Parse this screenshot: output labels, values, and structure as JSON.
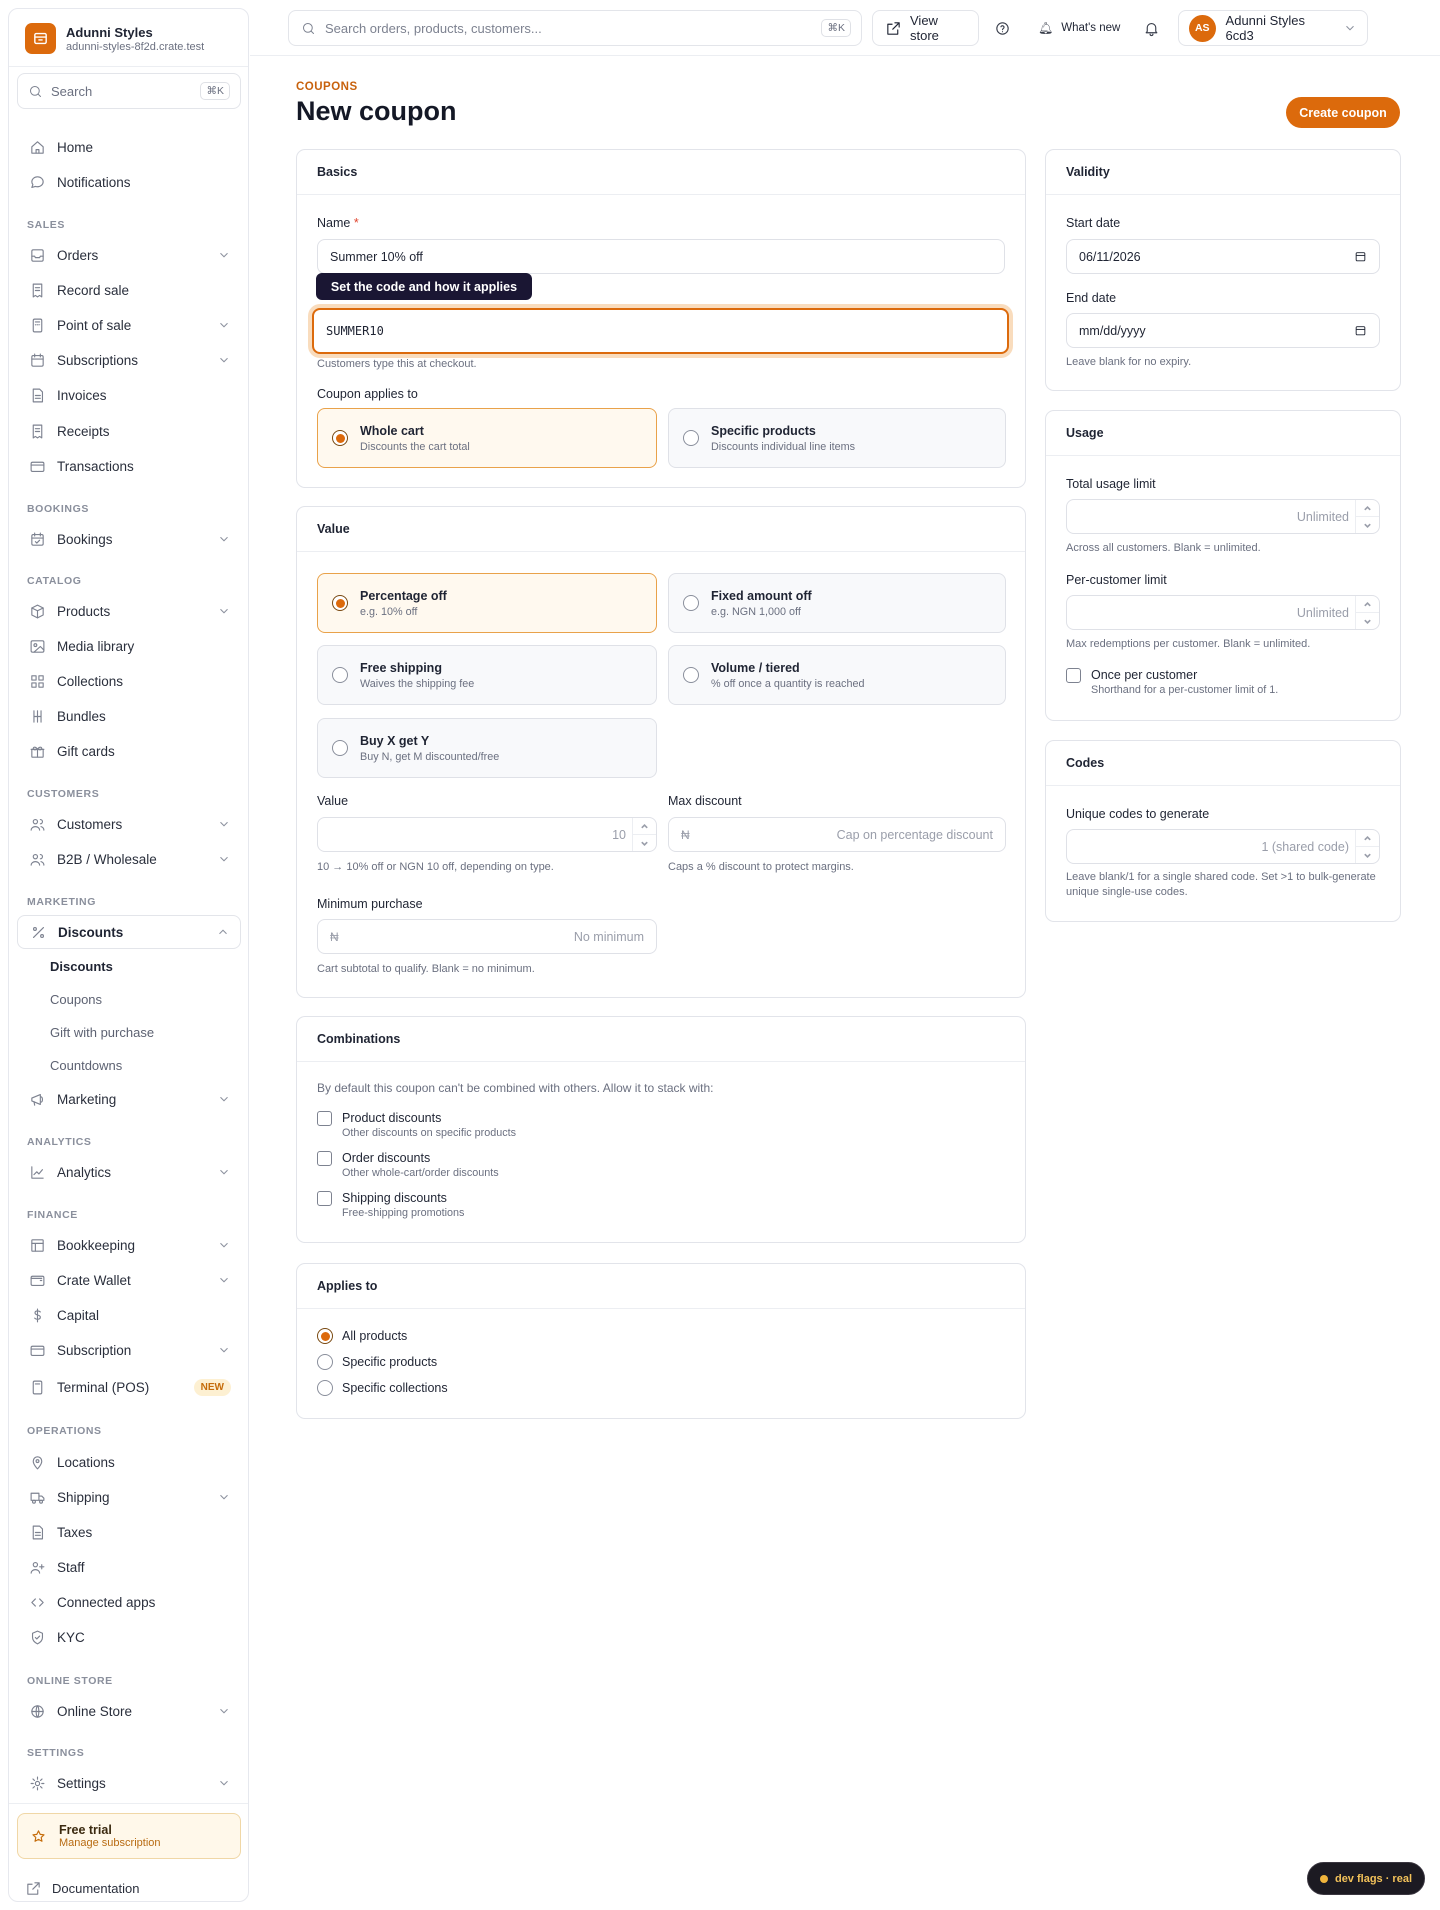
{
  "brand": {
    "name": "Adunni Styles",
    "domain": "adunni-styles-8f2d.crate.test"
  },
  "sidebar_search": {
    "placeholder": "Search",
    "shortcut": "⌘K"
  },
  "nav": {
    "home": "Home",
    "notifications": "Notifications",
    "sales": "SALES",
    "orders": "Orders",
    "record_sale": "Record sale",
    "pos": "Point of sale",
    "subscriptions": "Subscriptions",
    "invoices": "Invoices",
    "receipts": "Receipts",
    "transactions": "Transactions",
    "bookings_section": "BOOKINGS",
    "bookings": "Bookings",
    "catalog": "CATALOG",
    "products": "Products",
    "media": "Media library",
    "collections": "Collections",
    "bundles": "Bundles",
    "gift_cards": "Gift cards",
    "customers_section": "CUSTOMERS",
    "customers": "Customers",
    "b2b": "B2B / Wholesale",
    "marketing_section": "MARKETING",
    "discounts": "Discounts",
    "sub_discounts": "Discounts",
    "sub_coupons": "Coupons",
    "sub_gift": "Gift with purchase",
    "sub_countdowns": "Countdowns",
    "marketing": "Marketing",
    "analytics_section": "ANALYTICS",
    "analytics": "Analytics",
    "finance_section": "FINANCE",
    "bookkeeping": "Bookkeeping",
    "wallet": "Crate Wallet",
    "capital": "Capital",
    "subscription": "Subscription",
    "terminal": "Terminal (POS)",
    "terminal_badge": "NEW",
    "operations_section": "OPERATIONS",
    "locations": "Locations",
    "shipping": "Shipping",
    "taxes": "Taxes",
    "staff": "Staff",
    "connected_apps": "Connected apps",
    "kyc": "KYC",
    "online_section": "ONLINE STORE",
    "online_store": "Online Store",
    "settings_section": "SETTINGS",
    "settings": "Settings"
  },
  "trial": {
    "title": "Free trial",
    "subtitle": "Manage subscription"
  },
  "docs": "Documentation",
  "topbar": {
    "search_placeholder": "Search orders, products, customers...",
    "shortcut": "⌘K",
    "view_store": "View store",
    "whats_new": "What's new",
    "account": "Adunni Styles 6cd3",
    "avatar": "AS"
  },
  "header": {
    "eyebrow": "COUPONS",
    "title": "New coupon",
    "create": "Create coupon"
  },
  "basics": {
    "title": "Basics",
    "name_label": "Name",
    "name_value": "Summer 10% off",
    "tooltip": "Set the code and how it applies",
    "code_value": "SUMMER10",
    "code_help": "Customers type this at checkout.",
    "applies_label": "Coupon applies to",
    "options": [
      {
        "title": "Whole cart",
        "desc": "Discounts the cart total"
      },
      {
        "title": "Specific products",
        "desc": "Discounts individual line items"
      }
    ]
  },
  "value": {
    "title": "Value",
    "types": [
      {
        "title": "Percentage off",
        "desc": "e.g. 10% off"
      },
      {
        "title": "Fixed amount off",
        "desc": "e.g. NGN 1,000 off"
      },
      {
        "title": "Free shipping",
        "desc": "Waives the shipping fee"
      },
      {
        "title": "Volume / tiered",
        "desc": "% off once a quantity is reached"
      },
      {
        "title": "Buy X get Y",
        "desc": "Buy N, get M discounted/free"
      }
    ],
    "value_label": "Value",
    "value_placeholder": "10",
    "value_help": "10 → 10% off or NGN 10 off, depending on type.",
    "max_label": "Max discount",
    "currency": "₦",
    "max_placeholder": "Cap on percentage discount",
    "max_help": "Caps a % discount to protect margins.",
    "min_label": "Minimum purchase",
    "min_placeholder": "No minimum",
    "min_help": "Cart subtotal to qualify. Blank = no minimum."
  },
  "combinations": {
    "title": "Combinations",
    "intro": "By default this coupon can't be combined with others. Allow it to stack with:",
    "items": [
      {
        "title": "Product discounts",
        "desc": "Other discounts on specific products"
      },
      {
        "title": "Order discounts",
        "desc": "Other whole-cart/order discounts"
      },
      {
        "title": "Shipping discounts",
        "desc": "Free-shipping promotions"
      }
    ]
  },
  "applies_to": {
    "title": "Applies to",
    "options": [
      "All products",
      "Specific products",
      "Specific collections"
    ]
  },
  "validity": {
    "title": "Validity",
    "start_label": "Start date",
    "start_value": "06/11/2026",
    "end_label": "End date",
    "end_placeholder": "mm/dd/yyyy",
    "end_help": "Leave blank for no expiry."
  },
  "usage": {
    "title": "Usage",
    "total_label": "Total usage limit",
    "total_placeholder": "Unlimited",
    "total_help": "Across all customers. Blank = unlimited.",
    "per_label": "Per-customer limit",
    "per_placeholder": "Unlimited",
    "per_help": "Max redemptions per customer. Blank = unlimited.",
    "once_title": "Once per customer",
    "once_desc": "Shorthand for a per-customer limit of 1."
  },
  "codes": {
    "title": "Codes",
    "label": "Unique codes to generate",
    "placeholder": "1 (shared code)",
    "help": "Leave blank/1 for a single shared code. Set >1 to bulk-generate unique single-use codes."
  },
  "devflag": "dev flags · real",
  "colors": {
    "accent": "#dc6a0c",
    "tooltip_bg": "#1a1633"
  }
}
